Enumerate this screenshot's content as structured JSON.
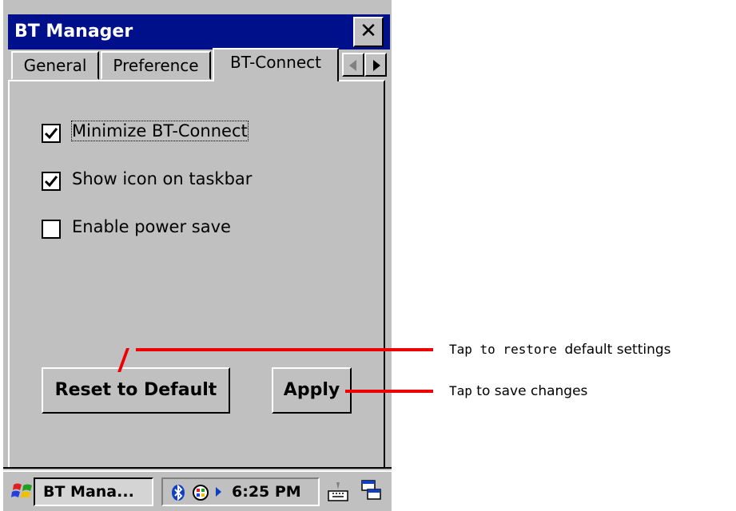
{
  "window": {
    "title": "BT Manager",
    "close_label": "✕"
  },
  "tabs": [
    {
      "label": "General",
      "active": false
    },
    {
      "label": "Preference",
      "active": false
    },
    {
      "label": "BT-Connect",
      "active": true
    }
  ],
  "options": [
    {
      "label": "Minimize BT-Connect",
      "checked": true
    },
    {
      "label": "Show icon on taskbar",
      "checked": true
    },
    {
      "label": "Enable power save",
      "checked": false
    }
  ],
  "buttons": {
    "reset": "Reset to Default",
    "apply": "Apply"
  },
  "taskbar": {
    "task_label": "BT Mana...",
    "time": "6:25 PM"
  },
  "callouts": {
    "restore_prefix": "Tap to restore ",
    "restore_suffix": "default settings",
    "save_prefix": "Tap",
    "save_suffix": " to save changes"
  },
  "colors": {
    "titlebar": "#00108a",
    "callout_line": "#ee0000",
    "dialog_bg": "#c0c0c0"
  }
}
